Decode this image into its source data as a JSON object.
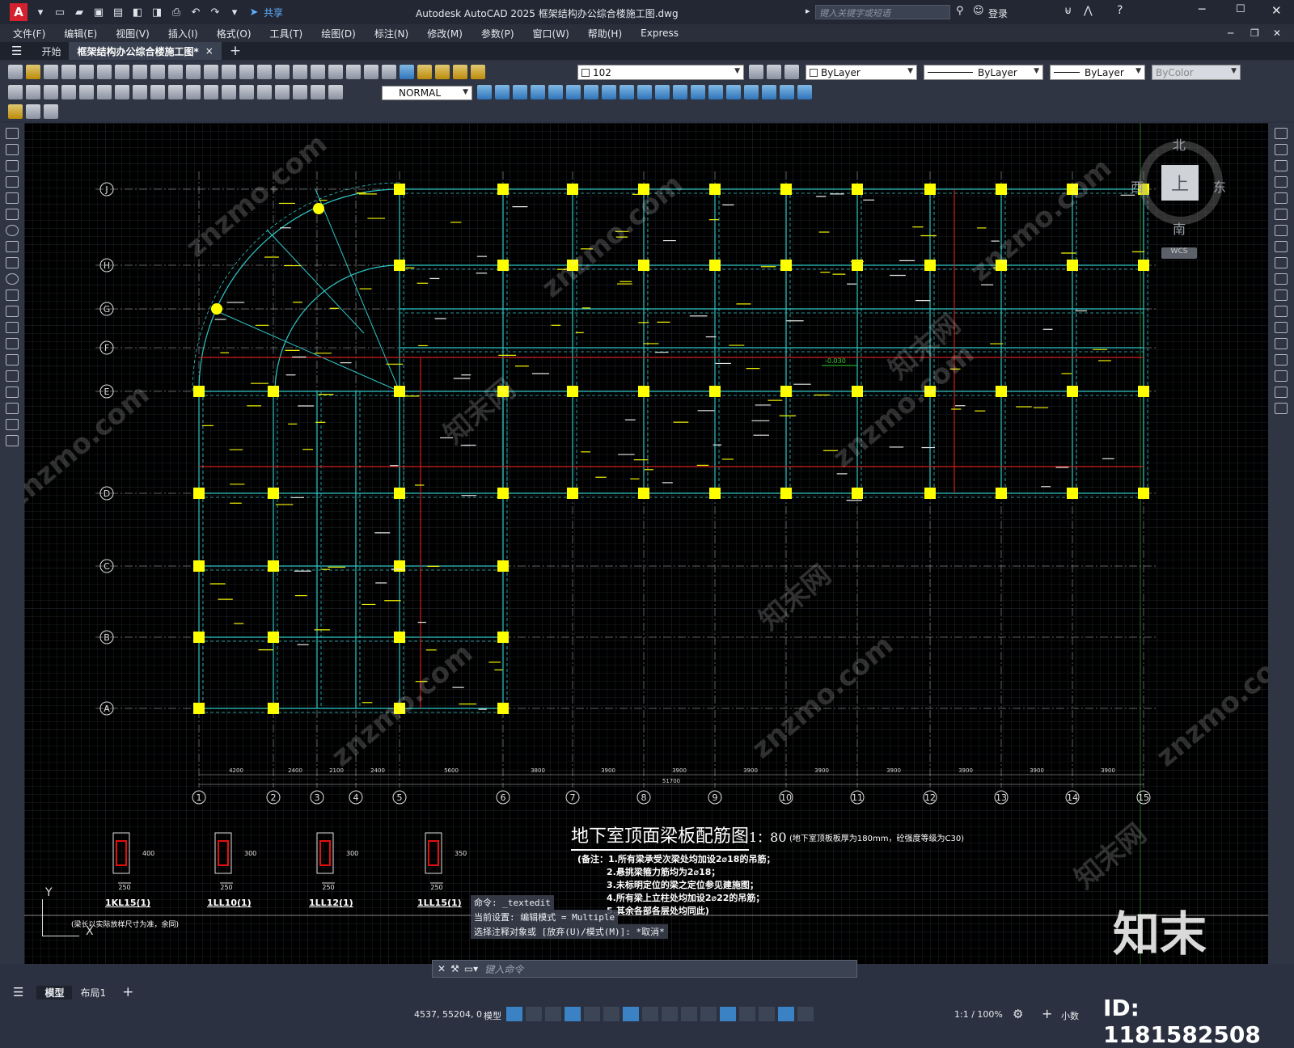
{
  "app": {
    "logo": "A",
    "title": "Autodesk AutoCAD 2025    框架结构办公综合楼施工图.dwg",
    "share": "共享",
    "search_placeholder": "键入关键字或短语",
    "login": "登录"
  },
  "menu": [
    "文件(F)",
    "编辑(E)",
    "视图(V)",
    "插入(I)",
    "格式(O)",
    "工具(T)",
    "绘图(D)",
    "标注(N)",
    "修改(M)",
    "参数(P)",
    "窗口(W)",
    "帮助(H)",
    "Express"
  ],
  "tabs": {
    "start": "开始",
    "document": "框架结构办公综合楼施工图*",
    "close": "×",
    "add": "+"
  },
  "properties": {
    "layer": "102",
    "color": "ByLayer",
    "linetype": "ByLayer",
    "lineweight": "ByLayer",
    "plotstyle": "ByColor",
    "dimstyle": "NORMAL"
  },
  "viewcube": {
    "north": "北",
    "south": "南",
    "east": "东",
    "west": "西",
    "face": "上",
    "wcs": "WCS"
  },
  "drawing": {
    "grid_rows": [
      "J",
      "H",
      "G",
      "F",
      "E",
      "D",
      "C",
      "B",
      "A"
    ],
    "grid_cols": [
      "1",
      "2",
      "3",
      "4",
      "5",
      "6",
      "7",
      "8",
      "9",
      "10",
      "11",
      "12",
      "13",
      "14",
      "15"
    ],
    "col_spacing": [
      "4200",
      "2400",
      "2100",
      "2400",
      "5600",
      "3800",
      "3900",
      "3900",
      "3900",
      "3900",
      "3900",
      "3900",
      "3900",
      "3900"
    ],
    "overall_dim": "51700",
    "title": "地下室顶面梁板配筋图",
    "scale": "1：80",
    "title_note": "(地下室顶板板厚为180mm，砼强度等级为C30)",
    "notes": [
      "(备注：1.所有梁承受次梁处均加设2⌀18的吊筋；",
      "2.悬挑梁箍力筋均为2⌀18；",
      "3.未标明定位的梁之定位参见建施图；",
      "4.所有梁上立柱处均加设2⌀22的吊筋；",
      "5.其余各部各层处均同此)"
    ],
    "sections": [
      {
        "label": "1KL15(1)",
        "width": "250",
        "height": "400"
      },
      {
        "label": "1LL10(1)",
        "width": "250",
        "height": "300"
      },
      {
        "label": "1LL12(1)",
        "width": "250",
        "height": "300"
      },
      {
        "label": "1LL15(1)",
        "width": "250",
        "height": "350"
      }
    ],
    "section_note": "(梁长以实际放样尺寸为准，余同)",
    "elevation_tag": "-0.030",
    "ucs_x": "X",
    "ucs_y": "Y"
  },
  "command": {
    "history": [
      "命令: _textedit",
      "当前设置: 编辑模式 = Multiple",
      "选择注释对象或 [放弃(U)/模式(M)]: *取消*"
    ],
    "placeholder": "键入命令"
  },
  "layout_tabs": {
    "model": "模型",
    "layout1": "布局1",
    "add": "+"
  },
  "status": {
    "coords": "4537, 55204, 0",
    "model": "模型",
    "scale": "1:1 / 100%",
    "units": "小数"
  },
  "watermarks": {
    "site": "znzmo.com",
    "brand": "知末网",
    "logo": "知末",
    "id": "ID: 1181582508"
  }
}
